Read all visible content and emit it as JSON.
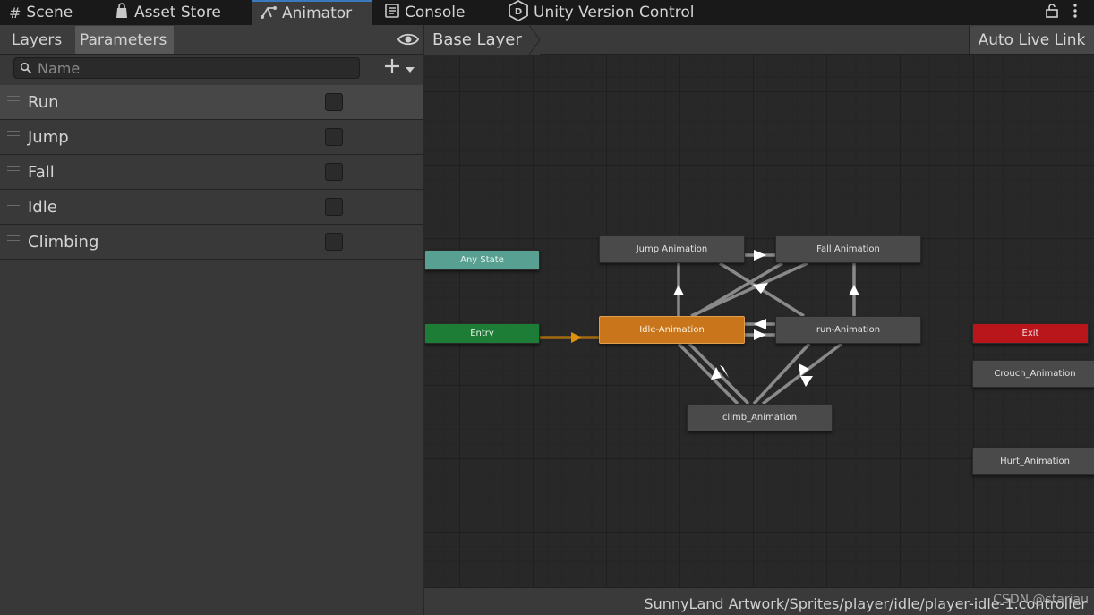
{
  "tabs": [
    {
      "label": "Scene",
      "icon": "grid-icon"
    },
    {
      "label": "Asset Store",
      "icon": "bag-icon"
    },
    {
      "label": "Animator",
      "icon": "animator-icon"
    },
    {
      "label": "Console",
      "icon": "console-icon"
    },
    {
      "label": "Unity Version Control",
      "icon": "version-control-icon"
    }
  ],
  "left_panel": {
    "tabs": {
      "layers": "Layers",
      "parameters": "Parameters"
    },
    "search": {
      "placeholder": "Name"
    },
    "parameters": [
      {
        "name": "Run",
        "checked": false,
        "selected": true
      },
      {
        "name": "Jump",
        "checked": false
      },
      {
        "name": "Fall",
        "checked": false
      },
      {
        "name": "Idle",
        "checked": false
      },
      {
        "name": "Climbing",
        "checked": false
      }
    ]
  },
  "graph": {
    "breadcrumb": "Base Layer",
    "auto_live_link": "Auto Live Link",
    "nodes": {
      "any_state": "Any State",
      "entry": "Entry",
      "exit": "Exit",
      "jump": "Jump Animation",
      "fall": "Fall Animation",
      "idle": "Idle-Animation",
      "run": "run-Animation",
      "climb": "climb_Animation",
      "crouch": "Crouch_Animation",
      "hurt": "Hurt_Animation"
    }
  },
  "status": {
    "path": "SunnyLand Artwork/Sprites/player/idle/player-idle-1.controller",
    "watermark": "CSDN @stariau"
  },
  "colors": {
    "accent": "#3a79bb",
    "any_state": "#58a092",
    "entry": "#1d7c35",
    "exit": "#b8161b",
    "default_state": "#c8751c"
  }
}
